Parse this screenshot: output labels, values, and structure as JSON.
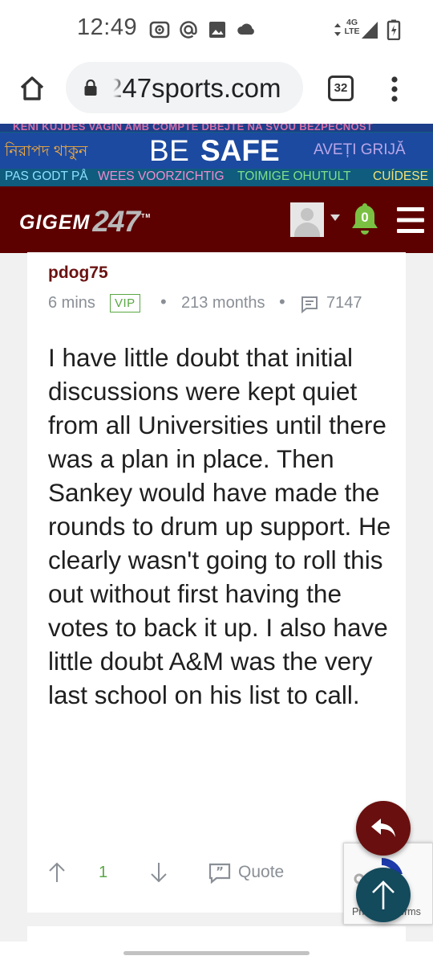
{
  "status_bar": {
    "time": "12:49",
    "network": "4G LTE",
    "icons": [
      "screen-record-icon",
      "at-icon",
      "image-icon",
      "cloud-icon",
      "data-arrows-icon",
      "signal-icon",
      "battery-charging-icon"
    ]
  },
  "browser": {
    "url": "247sports.com",
    "tab_count": "32",
    "icons": [
      "home-icon",
      "lock-icon",
      "tabs-icon",
      "overflow-menu-icon"
    ]
  },
  "banner": {
    "line1": "KENI KUJDES  VAGIN AMB COMPTE  DBEJTE NA SVOU BEZPEČNOST",
    "line2_left": "নিরাপদ থাকুন",
    "line2_center_be": "BE",
    "line2_center_safe": "SAFE",
    "line2_right": "AVEȚI GRIJĂ",
    "line3_a": "PAS GODT PÅ",
    "line3_b": "WEES VOORZICHTIG",
    "line3_c": "TOIMIGE OHUTULT",
    "line3_d": "CUÍDESE"
  },
  "site_header": {
    "logo_left": "GIGEM",
    "logo_right": "247",
    "logo_mark": "TM",
    "notification_count": "0",
    "icons": [
      "avatar-placeholder-icon",
      "caret-down-icon",
      "bell-icon",
      "hamburger-menu-icon"
    ]
  },
  "post": {
    "author": "pdog75",
    "time_ago": "6 mins",
    "badge": "VIP",
    "tenure": "213 months",
    "post_count": "7147",
    "body": "I have little doubt that initial discussions were kept quiet from all Universities until there was a plan in place. Then Sankey would have made the rounds to drum up support. He clearly wasn't going to roll this out without first having the votes to back it up. I also have little doubt A&M was the very last school on his list to call.",
    "upvotes": "1",
    "quote_label": "Quote"
  },
  "recaptcha": {
    "text": "Privacy - Terms"
  },
  "colors": {
    "header_maroon": "#5d0000",
    "author_maroon": "#6b1212",
    "vip_green": "#5aa844",
    "fab_maroon": "#6a0f0f",
    "fab_teal": "#134a5c",
    "banner_bg": "#10607a"
  }
}
